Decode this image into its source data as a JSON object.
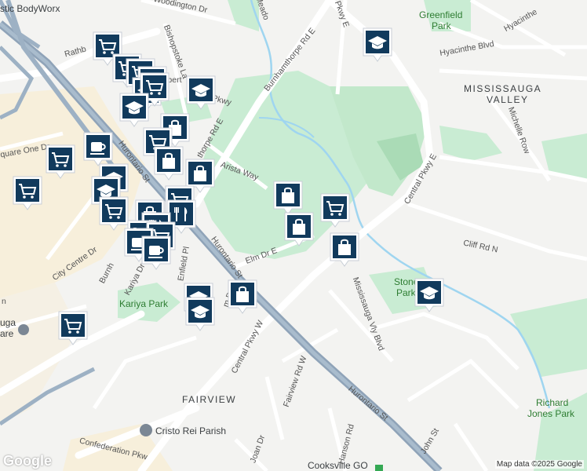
{
  "map": {
    "attribution": "Map data ©2025 Google",
    "logo": "Google",
    "areas": [
      {
        "id": "mississauga-valley-line1",
        "text": "MISSISSAUGA"
      },
      {
        "id": "mississauga-valley-line2",
        "text": "VALLEY"
      },
      {
        "id": "fairview",
        "text": "FAIRVIEW"
      }
    ],
    "parks": [
      {
        "id": "greenfield-line1",
        "text": "Greenfield"
      },
      {
        "id": "greenfield-line2",
        "text": "Park"
      },
      {
        "id": "stonebrook-line1",
        "text": "Stonebro"
      },
      {
        "id": "stonebrook-line2",
        "text": "Park"
      },
      {
        "id": "kariya-park",
        "text": "Kariya Park"
      },
      {
        "id": "richard-line1",
        "text": "Richard"
      },
      {
        "id": "richard-line2",
        "text": "Jones Park"
      }
    ],
    "pois": [
      {
        "id": "bodyworx",
        "text": "stic BodyWorx"
      },
      {
        "id": "cristo-rei",
        "text": "Cristo Rei Parish"
      },
      {
        "id": "square-one-line1",
        "text": "uga"
      },
      {
        "id": "square-one-line2",
        "text": "are"
      },
      {
        "id": "cooksville",
        "text": "Cooksville GO"
      }
    ],
    "roads": [
      {
        "id": "woodington",
        "text": "Woodington Dr"
      },
      {
        "id": "meadows",
        "text": "Meado"
      },
      {
        "id": "pkwy-e-top",
        "text": "Pkwy E"
      },
      {
        "id": "hyacinthe",
        "text": "Hyacinthe Blvd"
      },
      {
        "id": "hyacinthe-2",
        "text": "Hyacinthe"
      },
      {
        "id": "rathburn",
        "text": "Rathb"
      },
      {
        "id": "bishopstoke",
        "text": "Bishopstoke La"
      },
      {
        "id": "robert",
        "text": "Robert"
      },
      {
        "id": "pkwy-small",
        "text": "Pkwy"
      },
      {
        "id": "burnhamthorpe-e",
        "text": "Burnhamthorpe Rd E"
      },
      {
        "id": "burnhamthorpe-e-2",
        "text": "thorpe Rd E"
      },
      {
        "id": "michelle",
        "text": "Michelle Row"
      },
      {
        "id": "square-one-dr",
        "text": "quare One Dr"
      },
      {
        "id": "hurontario-top",
        "text": "Hurontario St"
      },
      {
        "id": "arista",
        "text": "Arista Way"
      },
      {
        "id": "central-pkwy-e",
        "text": "Central Pkwy E"
      },
      {
        "id": "cliff",
        "text": "Cliff Rd N"
      },
      {
        "id": "city-centre",
        "text": "City Centre Dr"
      },
      {
        "id": "elm",
        "text": "Elm Dr E"
      },
      {
        "id": "hurontario-mid",
        "text": "Hurontario St"
      },
      {
        "id": "burnh",
        "text": "Burnh"
      },
      {
        "id": "kariya-dr",
        "text": "Kariya Dr"
      },
      {
        "id": "enfield",
        "text": "Enfield Pl"
      },
      {
        "id": "mississauga-vly",
        "text": "Mississauga Vly Blvd"
      },
      {
        "id": "central-pkwy-w",
        "text": "Central Pkwy W"
      },
      {
        "id": "fairview-rd",
        "text": "Fairview Rd W"
      },
      {
        "id": "hurontario-bot",
        "text": "Hurontario St"
      },
      {
        "id": "john",
        "text": "John St"
      },
      {
        "id": "joan",
        "text": "Joan Dr"
      },
      {
        "id": "hanson",
        "text": "Hanson Rd"
      },
      {
        "id": "confederation",
        "text": "Confederation Pkw"
      },
      {
        "id": "m-dr",
        "text": "m Dr"
      },
      {
        "id": "n-left",
        "text": "n"
      }
    ],
    "markers": [
      {
        "type": "school",
        "icon": "school-icon"
      },
      {
        "type": "grocery",
        "icon": "shopping-cart-icon"
      },
      {
        "type": "shopping",
        "icon": "shopping-bag-icon"
      },
      {
        "type": "cafe",
        "icon": "coffee-cup-icon"
      },
      {
        "type": "restaurant",
        "icon": "fork-knife-icon"
      }
    ]
  }
}
